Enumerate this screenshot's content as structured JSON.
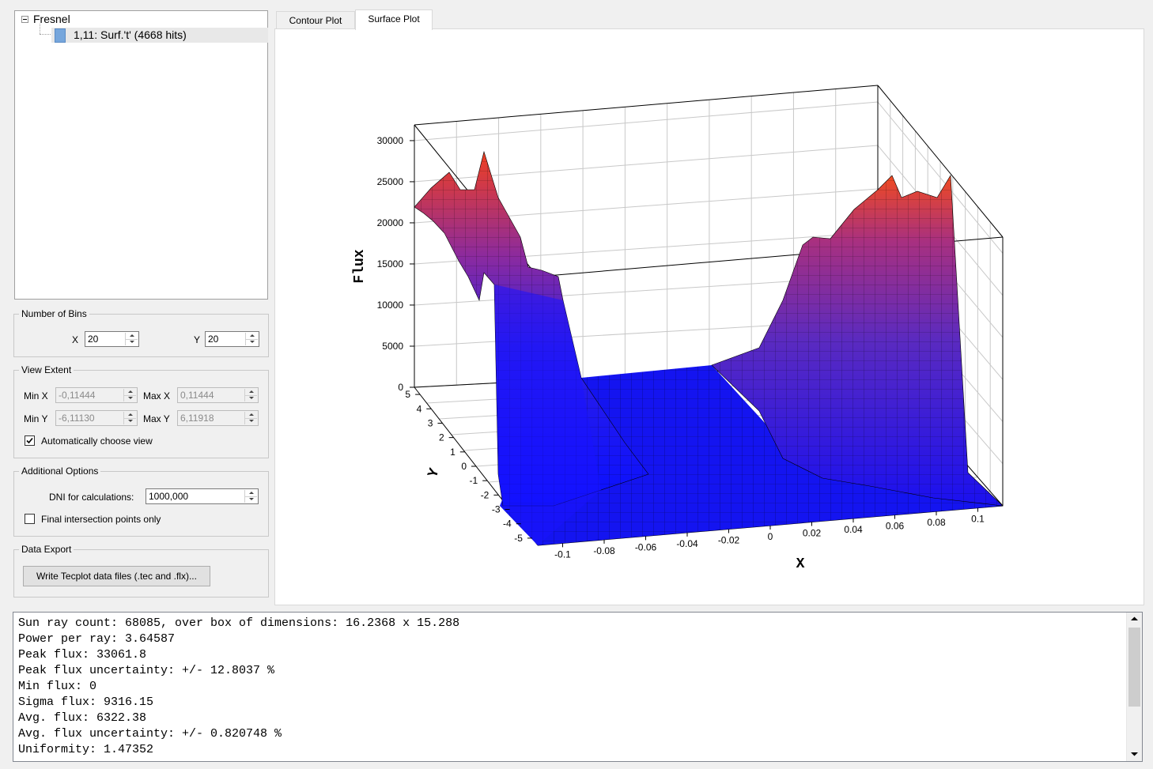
{
  "tree": {
    "root": "Fresnel",
    "child": "1,11: Surf.'t' (4668 hits)"
  },
  "bins": {
    "title": "Number of Bins",
    "x_label": "X",
    "x_value": "20",
    "y_label": "Y",
    "y_value": "20"
  },
  "extent": {
    "title": "View Extent",
    "minx_label": "Min X",
    "minx_value": "-0,11444",
    "maxx_label": "Max X",
    "maxx_value": "0,11444",
    "miny_label": "Min Y",
    "miny_value": "-6,11130",
    "maxy_label": "Max Y",
    "maxy_value": "6,11918",
    "auto_label": "Automatically choose view",
    "auto_checked": true
  },
  "options": {
    "title": "Additional Options",
    "dni_label": "DNI for calculations:",
    "dni_value": "1000,000",
    "final_label": "Final intersection points only",
    "final_checked": false
  },
  "export": {
    "title": "Data Export",
    "button_label": "Write Tecplot data files (.tec and .flx)..."
  },
  "tabs": [
    "Contour Plot",
    "Surface Plot"
  ],
  "active_tab": "Surface Plot",
  "chart_data": {
    "type": "surface",
    "zlabel": "Flux",
    "xlabel": "X",
    "ylabel": "Y",
    "z_ticks": [
      "0",
      "5000",
      "10000",
      "15000",
      "20000",
      "25000",
      "30000"
    ],
    "x_ticks": [
      "-0.1",
      "-0.08",
      "-0.06",
      "-0.04",
      "-0.02",
      "0",
      "0.02",
      "0.04",
      "0.06",
      "0.08",
      "0.1"
    ],
    "y_ticks": [
      "5",
      "4",
      "3",
      "2",
      "1",
      "0",
      "-1",
      "-2",
      "-3",
      "-4",
      "-5"
    ],
    "xlim": [
      -0.11444,
      0.11444
    ],
    "ylim": [
      -6.1113,
      6.11918
    ],
    "zlim": [
      0,
      33061.8
    ],
    "colormap": [
      "#0000ff",
      "#ff4500"
    ],
    "description_profile_x": [
      -0.114,
      -0.1,
      -0.08,
      -0.06,
      -0.04,
      -0.02,
      0,
      0.02,
      0.04,
      0.06,
      0.08,
      0.1,
      0.114
    ],
    "description_profile_flux": [
      22000,
      24000,
      15000,
      1500,
      200,
      100,
      100,
      200,
      4000,
      15000,
      22000,
      26000,
      28000
    ]
  },
  "output": {
    "lines": [
      "Sun ray count: 68085, over box of dimensions: 16.2368 x 15.288",
      "Power per ray: 3.64587",
      "Peak flux: 33061.8",
      "Peak flux uncertainty: +/- 12.8037 %",
      "Min flux: 0",
      "Sigma flux: 9316.15",
      "Avg. flux: 6322.38",
      "Avg. flux uncertainty: +/- 0.820748 %",
      "Uniformity: 1.47352"
    ]
  }
}
